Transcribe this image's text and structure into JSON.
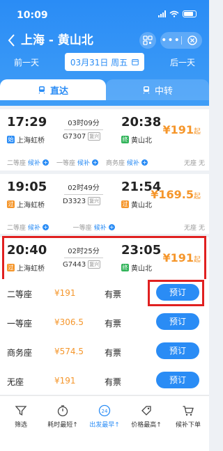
{
  "status_bar": {
    "time": "10:09"
  },
  "header": {
    "route": "上海 - 黄山北",
    "prev_day": "前一天",
    "next_day": "后一天",
    "date": "03月31日 周五"
  },
  "tabs": [
    {
      "label": "直达"
    },
    {
      "label": "中转"
    }
  ],
  "trains": [
    {
      "dep_time": "17:29",
      "arr_time": "20:38",
      "duration": "03时09分",
      "train_no": "G7307",
      "tag": "复兴",
      "dep_station": "上海虹桥",
      "arr_station": "黄山北",
      "price": "¥191",
      "price_suffix": "起",
      "seats": [
        {
          "name": "二等座",
          "status": "候补"
        },
        {
          "name": "一等座",
          "status": "候补"
        },
        {
          "name": "商务座",
          "status": "候补"
        },
        {
          "name": "无座",
          "status": "无"
        }
      ]
    },
    {
      "dep_time": "19:05",
      "arr_time": "21:54",
      "duration": "02时49分",
      "train_no": "D3323",
      "tag": "复兴",
      "dep_station": "上海虹桥",
      "arr_station": "黄山北",
      "price": "¥169.5",
      "price_suffix": "起",
      "seats": [
        {
          "name": "二等座",
          "status": "候补"
        },
        {
          "name": "一等座",
          "status": "候补"
        },
        {
          "name": "无座",
          "status": "无"
        }
      ]
    },
    {
      "dep_time": "20:40",
      "arr_time": "23:05",
      "duration": "02时25分",
      "train_no": "G7443",
      "tag": "复兴",
      "dep_station": "上海虹桥",
      "arr_station": "黄山北",
      "price": "¥191",
      "price_suffix": "起"
    }
  ],
  "seat_classes": [
    {
      "name": "二等座",
      "price": "¥191",
      "availability": "有票",
      "button": "预订"
    },
    {
      "name": "一等座",
      "price": "¥306.5",
      "availability": "有票",
      "button": "预订"
    },
    {
      "name": "商务座",
      "price": "¥574.5",
      "availability": "有票",
      "button": "预订"
    },
    {
      "name": "无座",
      "price": "¥191",
      "availability": "有票",
      "button": "预订"
    }
  ],
  "bottom_bar": [
    {
      "label": "筛选",
      "icon": "filter-icon"
    },
    {
      "label": "耗时最短↑",
      "icon": "timer-icon"
    },
    {
      "label": "出发最早↑",
      "icon": "clock-24-icon",
      "badge": "24"
    },
    {
      "label": "价格最高↑",
      "icon": "price-tag-icon"
    },
    {
      "label": "候补下单",
      "icon": "cart-icon"
    }
  ],
  "colors": {
    "brand_blue": "#2a8cf5",
    "price_orange": "#f5962b",
    "highlight_red": "#e02020"
  }
}
